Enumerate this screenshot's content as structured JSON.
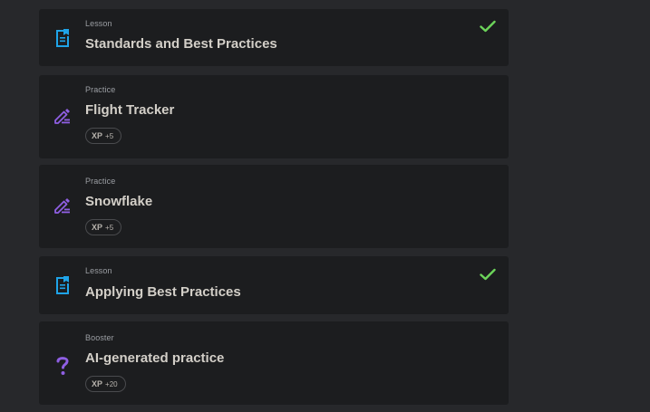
{
  "items": [
    {
      "type": "Lesson",
      "title": "Standards and Best Practices",
      "icon": "lesson-document-icon",
      "completed": true
    },
    {
      "type": "Practice",
      "title": "Flight Tracker",
      "icon": "practice-pencil-icon",
      "xp_label": "XP",
      "xp_value": "+5"
    },
    {
      "type": "Practice",
      "title": "Snowflake",
      "icon": "practice-pencil-icon",
      "xp_label": "XP",
      "xp_value": "+5"
    },
    {
      "type": "Lesson",
      "title": "Applying Best Practices",
      "icon": "lesson-document-icon",
      "completed": true
    },
    {
      "type": "Booster",
      "title": "AI-generated practice",
      "icon": "booster-question-icon",
      "xp_label": "XP",
      "xp_value": "+20"
    }
  ],
  "colors": {
    "lesson_icon": "#1fa4e8",
    "practice_icon": "#8f5fe3",
    "check": "#6cd45a",
    "card_bg": "#1c1d1f",
    "page_bg": "#27282b"
  }
}
